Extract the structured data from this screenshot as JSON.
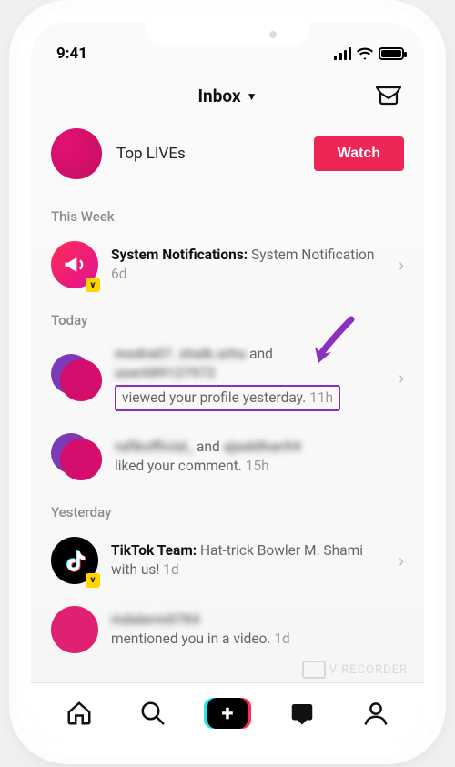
{
  "status": {
    "time": "9:41"
  },
  "header": {
    "title": "Inbox"
  },
  "live_banner": {
    "title": "Top LIVEs",
    "watch_label": "Watch"
  },
  "sections": {
    "this_week": "This Week",
    "today": "Today",
    "yesterday": "Yesterday"
  },
  "notifications": {
    "system": {
      "title_bold": "System Notifications:",
      "title_rest": "System Notification",
      "time": "6d",
      "badge": "v"
    },
    "profile_view": {
      "line1_connector": "and",
      "highlight_text": "viewed your profile yesterday.",
      "time": "11h"
    },
    "comment_like": {
      "connector": "and",
      "body": "liked your comment.",
      "time": "15h"
    },
    "tiktok_team": {
      "title_bold": "TikTok Team:",
      "title_rest": "Hat-trick Bowler M. Shami with us!",
      "time": "1d",
      "badge": "v"
    },
    "mention": {
      "body": "mentioned you in a video.",
      "time": "1d"
    }
  },
  "watermark": "V RECORDER"
}
